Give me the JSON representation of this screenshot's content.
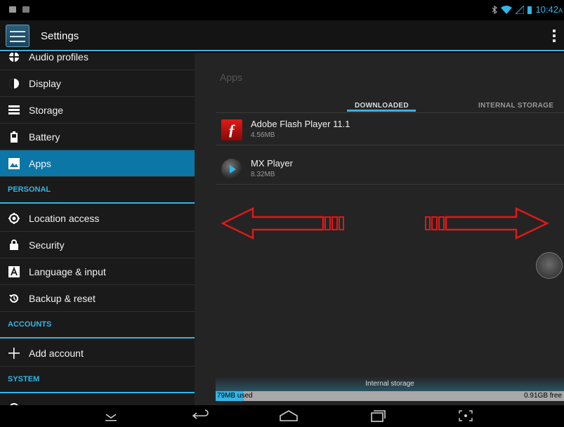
{
  "status_bar": {
    "time": "10:42",
    "time_suffix": "A"
  },
  "action_bar": {
    "title": "Settings"
  },
  "sidebar": {
    "items": [
      {
        "label": "Audio profiles"
      },
      {
        "label": "Display"
      },
      {
        "label": "Storage"
      },
      {
        "label": "Battery"
      },
      {
        "label": "Apps",
        "selected": true
      }
    ],
    "sections": {
      "personal": {
        "header": "PERSONAL",
        "items": [
          {
            "label": "Location access"
          },
          {
            "label": "Security"
          },
          {
            "label": "Language & input"
          },
          {
            "label": "Backup & reset"
          }
        ]
      },
      "accounts": {
        "header": "ACCOUNTS",
        "items": [
          {
            "label": "Add account"
          }
        ]
      },
      "system": {
        "header": "SYSTEM"
      }
    }
  },
  "content": {
    "title": "Apps",
    "tabs": {
      "downloaded": "DOWNLOADED",
      "internal": "INTERNAL STORAGE"
    },
    "apps": [
      {
        "name": "Adobe Flash Player 11.1",
        "size": "4.56MB",
        "icon": "flash-icon"
      },
      {
        "name": "MX Player",
        "size": "8.32MB",
        "icon": "mx-player-icon"
      }
    ],
    "storage": {
      "label": "Internal storage",
      "used": "79MB used",
      "free": "0.91GB free",
      "used_fraction": 0.08
    }
  },
  "colors": {
    "accent": "#33b5e5",
    "selected": "#0c76a6",
    "arrow": "#e01818"
  }
}
